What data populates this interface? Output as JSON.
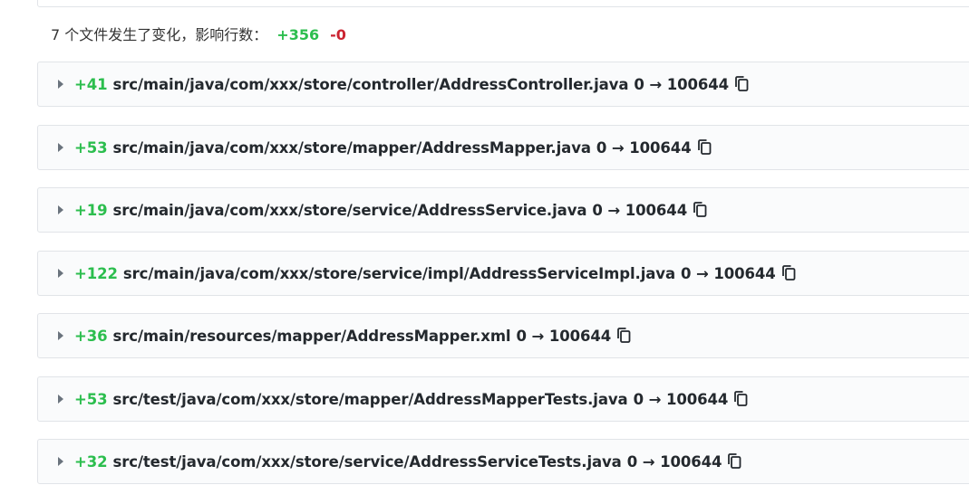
{
  "summary": {
    "text": "7 个文件发生了变化，影响行数：",
    "additions": "+356",
    "deletions": "-0"
  },
  "files": [
    {
      "lines": "+41",
      "path": "src/main/java/com/xxx/store/controller/AddressController.java",
      "mode": "0 → 100644",
      "icon": "copy-icon"
    },
    {
      "lines": "+53",
      "path": "src/main/java/com/xxx/store/mapper/AddressMapper.java",
      "mode": "0 → 100644",
      "icon": "copy-icon"
    },
    {
      "lines": "+19",
      "path": "src/main/java/com/xxx/store/service/AddressService.java",
      "mode": "0 → 100644",
      "icon": "copy-icon"
    },
    {
      "lines": "+122",
      "path": "src/main/java/com/xxx/store/service/impl/AddressServiceImpl.java",
      "mode": "0 → 100644",
      "icon": "copy-icon"
    },
    {
      "lines": "+36",
      "path": "src/main/resources/mapper/AddressMapper.xml",
      "mode": "0 → 100644",
      "icon": "copy-icon"
    },
    {
      "lines": "+53",
      "path": "src/test/java/com/xxx/store/mapper/AddressMapperTests.java",
      "mode": "0 → 100644",
      "icon": "copy-icon"
    },
    {
      "lines": "+32",
      "path": "src/test/java/com/xxx/store/service/AddressServiceTests.java",
      "mode": "0 → 100644",
      "icon": "copy-icon"
    }
  ],
  "colors": {
    "additions": "#2cbe4e",
    "deletions": "#cb2431"
  }
}
